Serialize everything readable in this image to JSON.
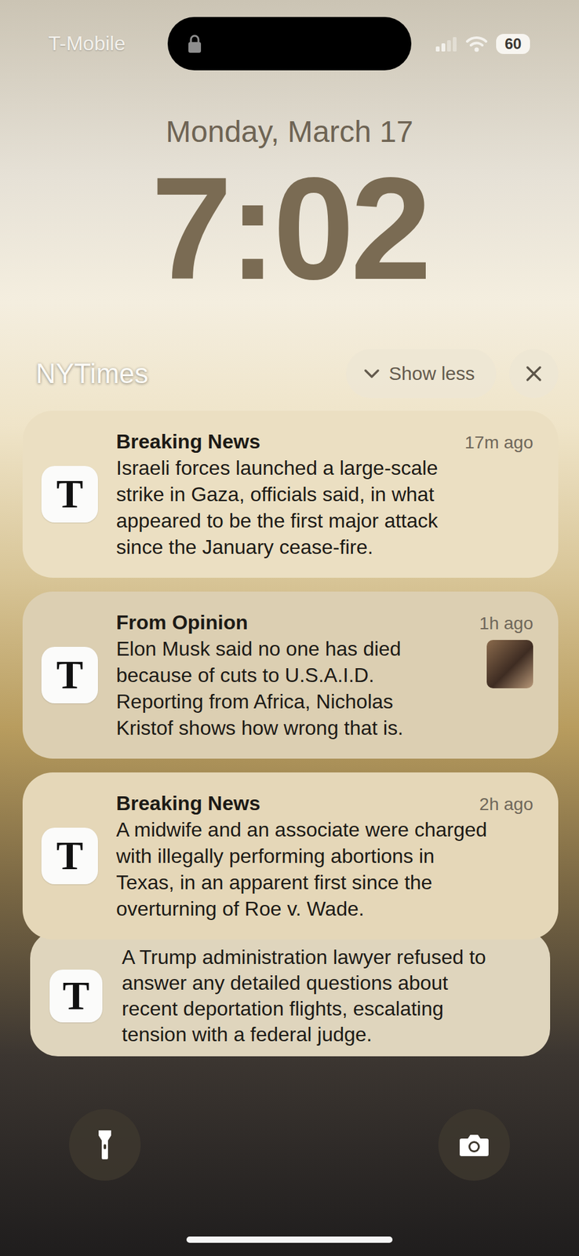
{
  "status_bar": {
    "carrier": "T-Mobile",
    "battery": "60"
  },
  "lock": {
    "date": "Monday, March 17",
    "time": "7:02"
  },
  "group": {
    "app": "NYTimes",
    "show_less": "Show less"
  },
  "app_icon": {
    "letter": "T"
  },
  "notifications": [
    {
      "kind": "full",
      "title": "Breaking News",
      "time": "17m ago",
      "has_thumbnail": false,
      "lines": [
        "Israeli forces launched a large-scale",
        "strike in Gaza, officials said, in what",
        "appeared to be the first major attack",
        "since the January cease-fire."
      ]
    },
    {
      "kind": "full",
      "title": "From Opinion",
      "time": "1h ago",
      "has_thumbnail": true,
      "lines": [
        "Elon Musk said no one has died",
        "because of cuts to U.S.A.I.D.",
        "Reporting from Africa, Nicholas",
        "Kristof shows how wrong that is."
      ]
    },
    {
      "kind": "full",
      "title": "Breaking News",
      "time": "2h ago",
      "has_thumbnail": false,
      "lines": [
        "A midwife and an associate were charged",
        "with illegally performing abortions in",
        "Texas, in an apparent first since the",
        "overturning of Roe v. Wade."
      ]
    },
    {
      "kind": "stacked",
      "has_thumbnail": false,
      "lines": [
        "A Trump administration lawyer refused to",
        "answer any detailed questions about",
        "recent deportation flights, escalating",
        "tension with a federal judge."
      ]
    }
  ]
}
